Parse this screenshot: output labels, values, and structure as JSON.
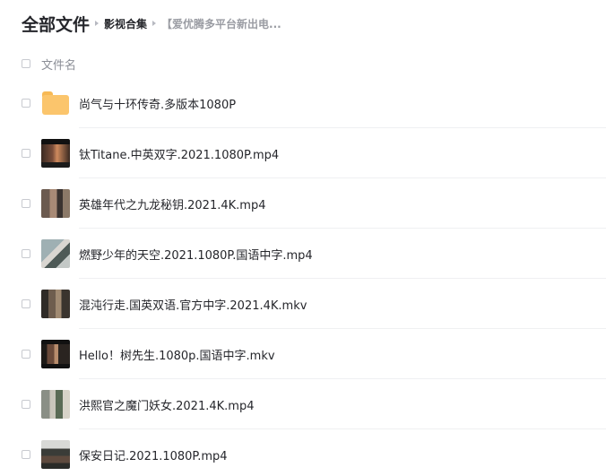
{
  "breadcrumb": {
    "root": "全部文件",
    "middle": "影视合集",
    "current": "【爱优腾多平台新出电..."
  },
  "list": {
    "header_label": "文件名",
    "items": [
      {
        "name": "尚气与十环传奇.多版本1080P",
        "type": "folder",
        "icon": "folder-icon"
      },
      {
        "name": "钛Titane.中英双字.2021.1080P.mp4",
        "type": "video",
        "icon": "video-thumbnail"
      },
      {
        "name": "英雄年代之九龙秘钥.2021.4K.mp4",
        "type": "video",
        "icon": "video-thumbnail"
      },
      {
        "name": "燃野少年的天空.2021.1080P.国语中字.mp4",
        "type": "video",
        "icon": "video-thumbnail"
      },
      {
        "name": "混沌行走.国英双语.官方中字.2021.4K.mkv",
        "type": "video",
        "icon": "video-thumbnail"
      },
      {
        "name": "Hello！树先生.1080p.国语中字.mkv",
        "type": "video",
        "icon": "video-thumbnail"
      },
      {
        "name": "洪熙官之魔门妖女.2021.4K.mp4",
        "type": "video",
        "icon": "video-thumbnail"
      },
      {
        "name": "保安日记.2021.1080P.mp4",
        "type": "video",
        "icon": "video-thumbnail"
      }
    ]
  },
  "colors": {
    "text_primary": "#25262b",
    "text_muted": "#9a9ca3",
    "folder": "#fbc56c",
    "divider": "#eff0f2"
  }
}
